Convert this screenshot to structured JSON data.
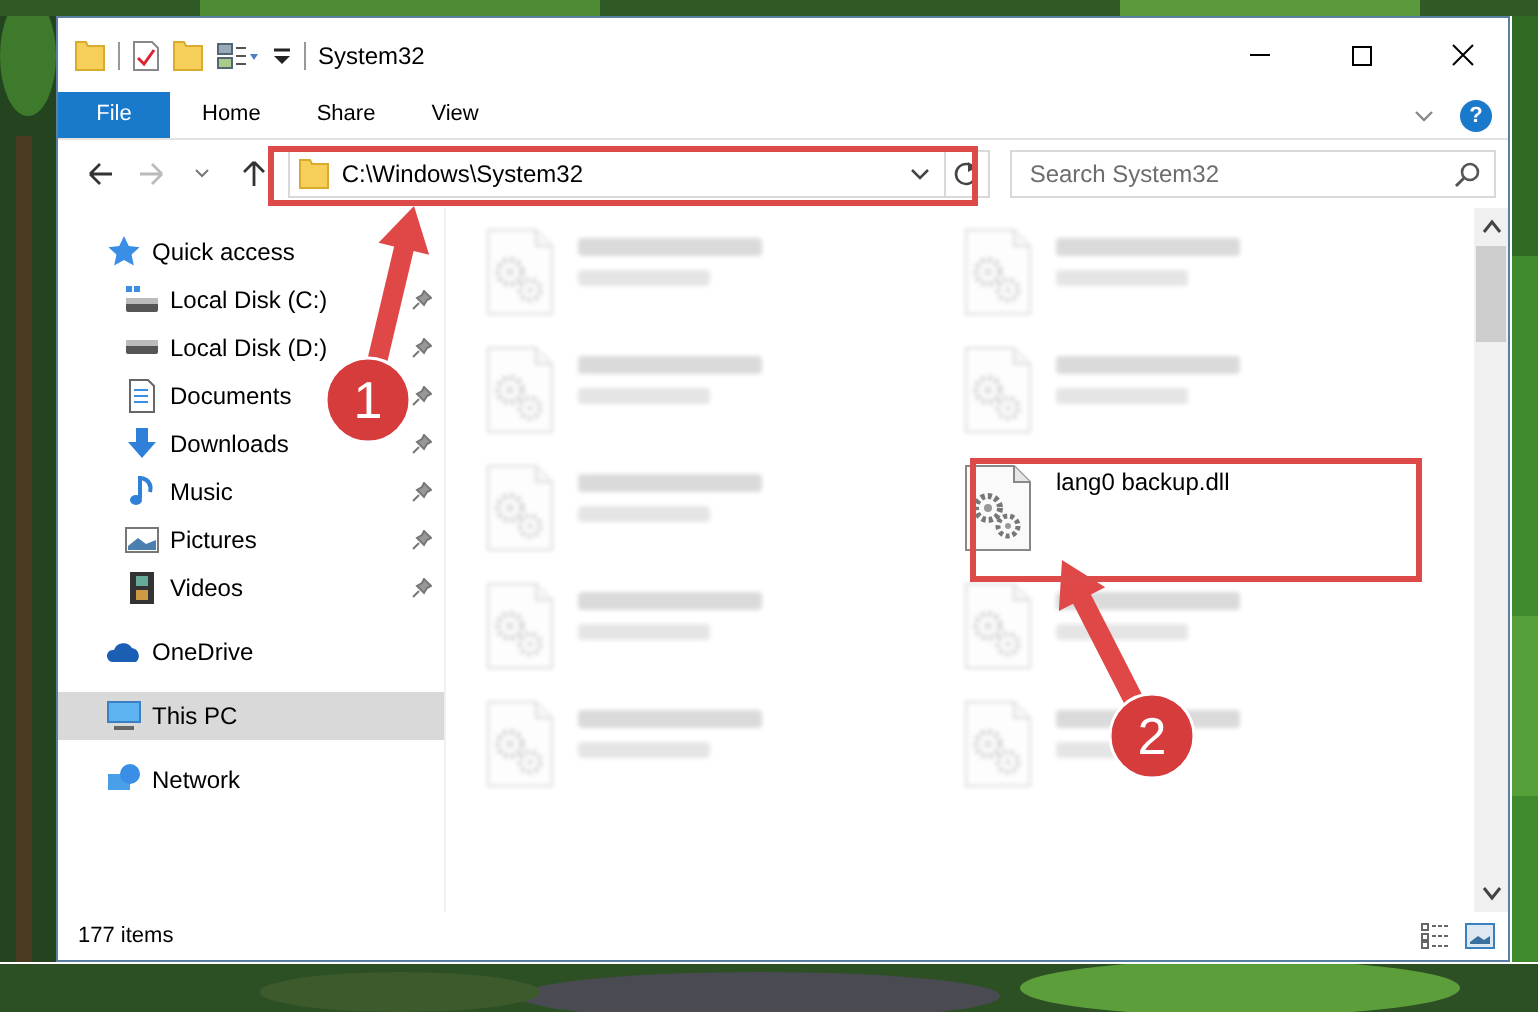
{
  "window": {
    "title": "System32"
  },
  "ribbon_tabs": [
    {
      "label": "File",
      "kind": "file",
      "selected": false
    },
    {
      "label": "Home",
      "kind": "tab",
      "selected": false
    },
    {
      "label": "Share",
      "kind": "tab",
      "selected": false
    },
    {
      "label": "View",
      "kind": "tab",
      "selected": false
    }
  ],
  "help_button": "?",
  "address_bar": {
    "path": "C:\\Windows\\System32"
  },
  "search": {
    "placeholder": "Search System32"
  },
  "sidebar": {
    "items": [
      {
        "label": "Quick access",
        "kind": "quick",
        "selected": false,
        "children": [
          {
            "label": "Local Disk (C:)",
            "kind": "disk-c",
            "pinned": true
          },
          {
            "label": "Local Disk (D:)",
            "kind": "disk",
            "pinned": true
          },
          {
            "label": "Documents",
            "kind": "documents",
            "pinned": true
          },
          {
            "label": "Downloads",
            "kind": "downloads",
            "pinned": true
          },
          {
            "label": "Music",
            "kind": "music",
            "pinned": true
          },
          {
            "label": "Pictures",
            "kind": "pictures",
            "pinned": true
          },
          {
            "label": "Videos",
            "kind": "videos",
            "pinned": true
          }
        ]
      },
      {
        "label": "OneDrive",
        "kind": "cloud",
        "selected": false
      },
      {
        "label": "This PC",
        "kind": "pc",
        "selected": true
      },
      {
        "label": "Network",
        "kind": "network",
        "selected": false
      }
    ]
  },
  "files": [
    {
      "blurred": true
    },
    {
      "blurred": true
    },
    {
      "blurred": true
    },
    {
      "blurred": true
    },
    {
      "blurred": true
    },
    {
      "name": "lang0 backup.dll",
      "blurred": false
    },
    {
      "blurred": true
    },
    {
      "blurred": true
    },
    {
      "blurred": true
    },
    {
      "blurred": true
    }
  ],
  "status_bar": {
    "item_count": "177 items"
  },
  "annotations": [
    {
      "label": "1"
    },
    {
      "label": "2"
    }
  ]
}
